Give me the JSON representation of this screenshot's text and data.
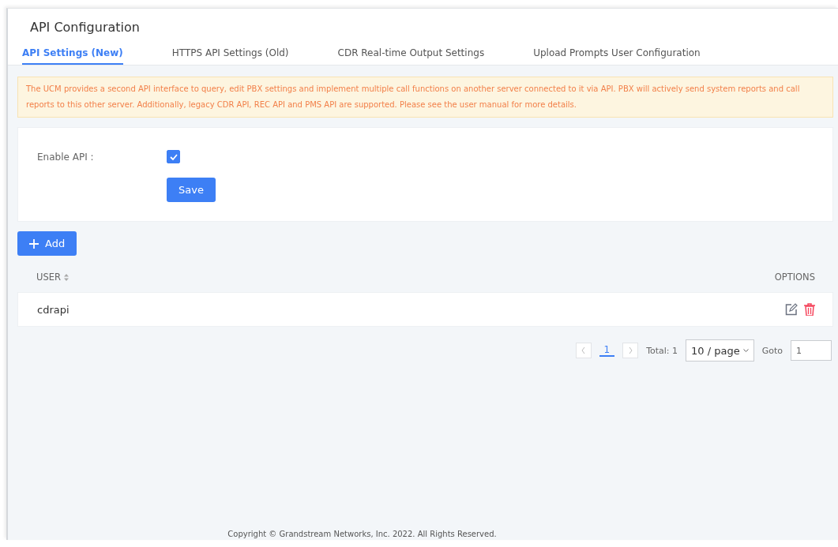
{
  "page": {
    "title": "API Configuration"
  },
  "tabs": [
    {
      "label": "API Settings (New)",
      "selected": true
    },
    {
      "label": "HTTPS API Settings (Old)",
      "selected": false
    },
    {
      "label": "CDR Real-time Output Settings",
      "selected": false
    },
    {
      "label": "Upload Prompts User Configuration",
      "selected": false
    }
  ],
  "notice": "The UCM provides a second API interface to query, edit PBX settings and implement multiple call functions on another server connected to it via API. PBX will actively send system reports and call reports to this other server. Additionally, legacy CDR API, REC API and PMS API are supported. Please see the user manual for more details.",
  "form": {
    "enable_api": {
      "label": "Enable API :",
      "checked": true
    },
    "save_button": "Save"
  },
  "add_button": "Add",
  "table": {
    "columns": [
      "USER",
      "OPTIONS"
    ],
    "rows": [
      {
        "user": "cdrapi"
      }
    ]
  },
  "pagination": {
    "pages": [
      {
        "label": "1",
        "selected": true
      }
    ],
    "total": "Total: 1",
    "page_size": "10 / page",
    "goto_label": "Goto",
    "goto_value": "1"
  },
  "footer": "Copyright © Grandstream Networks, Inc. 2022. All Rights Reserved."
}
